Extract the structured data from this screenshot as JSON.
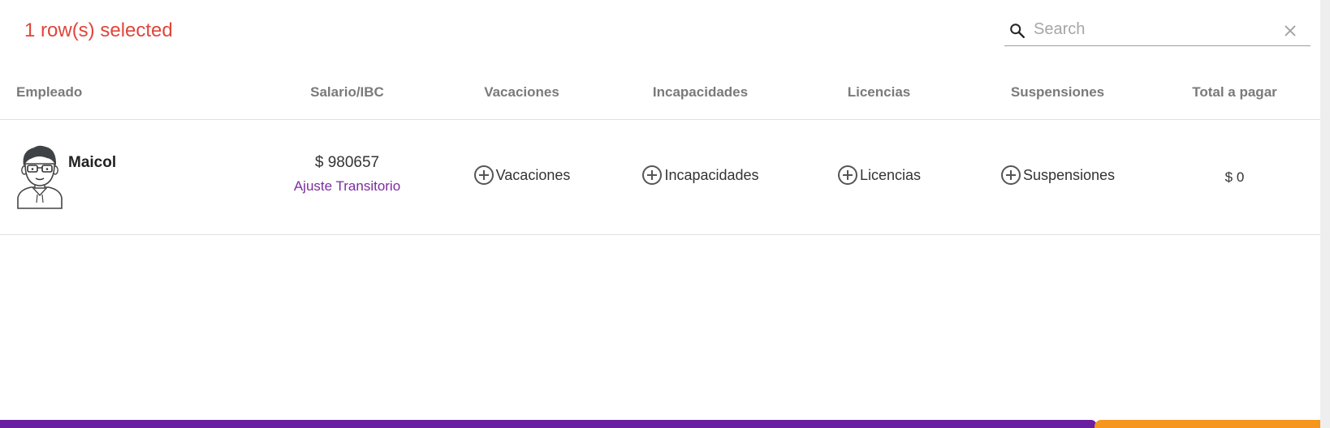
{
  "toolbar": {
    "selected_text": "1 row(s) selected",
    "search": {
      "placeholder": "Search",
      "value": "",
      "icon": "search-icon",
      "clear_icon": "close-icon"
    }
  },
  "table": {
    "columns": [
      "Empleado",
      "Salario/IBC",
      "Vacaciones",
      "Incapacidades",
      "Licencias",
      "Suspensiones",
      "Total a pagar"
    ],
    "rows": [
      {
        "avatar": "avatar-icon",
        "employee": "Maicol",
        "salary": "$ 980657",
        "salary_link": "Ajuste Transitorio",
        "vacaciones": "Vacaciones",
        "incapacidades": "Incapacidades",
        "licencias": "Licencias",
        "suspensiones": "Suspensiones",
        "total": "$ 0"
      }
    ]
  },
  "colors": {
    "selected_text": "#e0453a",
    "link": "#7b2d9e",
    "bar_purple": "#6a1fa0",
    "bar_orange": "#f5961e"
  }
}
